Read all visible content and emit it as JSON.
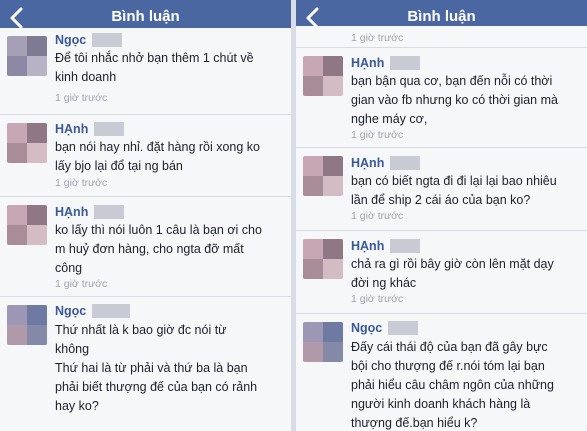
{
  "left": {
    "title": "Bình luận",
    "comments": [
      {
        "author": "Ngọc",
        "text": [
          "Để tôi nhắc nhở bạn thêm 1 chút về",
          "kinh doanh"
        ],
        "time": "1 giờ trước"
      },
      {
        "author": "HẠnh",
        "text": [
          "bạn nói hay nhỉ. đặt hàng rồi xong ko",
          "lấy bjo lại đổ tại ng bán"
        ],
        "time": "1 giờ trước"
      },
      {
        "author": "HẠnh",
        "text": [
          "ko lấy thì nói luôn 1 câu là bạn ơi cho",
          "m huỷ đơn hàng, cho ngta đỡ mất",
          "công"
        ],
        "time": "1 giờ trước"
      },
      {
        "author": "Ngọc",
        "text": [
          "Thứ nhất là k bao giờ đc nói từ",
          "không",
          "Thứ hai là từ phải và thứ ba là bạn",
          "phải biết thượng đế của bạn có rảnh",
          "hay ko?"
        ]
      }
    ]
  },
  "right": {
    "title": "Bình luận",
    "first_time": "1 giờ trước",
    "comments": [
      {
        "author": "HẠnh",
        "text": [
          "bạn bận qua cơ, bạn đến nỗi có thời",
          "gian vào fb nhưng ko có thời gian mà",
          "nghe máy cơ,"
        ],
        "time": "1 giờ trước"
      },
      {
        "author": "HẠnh",
        "text": [
          "bạn có biết ngta đi đi lại lại bao nhiêu",
          "lần để ship 2 cái áo của bạn ko?"
        ],
        "time": "1 giờ trước"
      },
      {
        "author": "HẠnh",
        "text": [
          "chả ra gì rồi bây giờ còn lên mặt dạy",
          "đời ng khác"
        ],
        "time": "1 giờ trước"
      },
      {
        "author": "Ngọc",
        "text": [
          "Đấy cái thái độ của bạn đã gây bực",
          "bội cho thượng đế r.nói tóm lại bạn",
          "phải hiểu câu châm ngôn của những",
          "người kinh doanh khách hàng là",
          "thượng đế.bạn hiểu k?"
        ]
      }
    ]
  }
}
